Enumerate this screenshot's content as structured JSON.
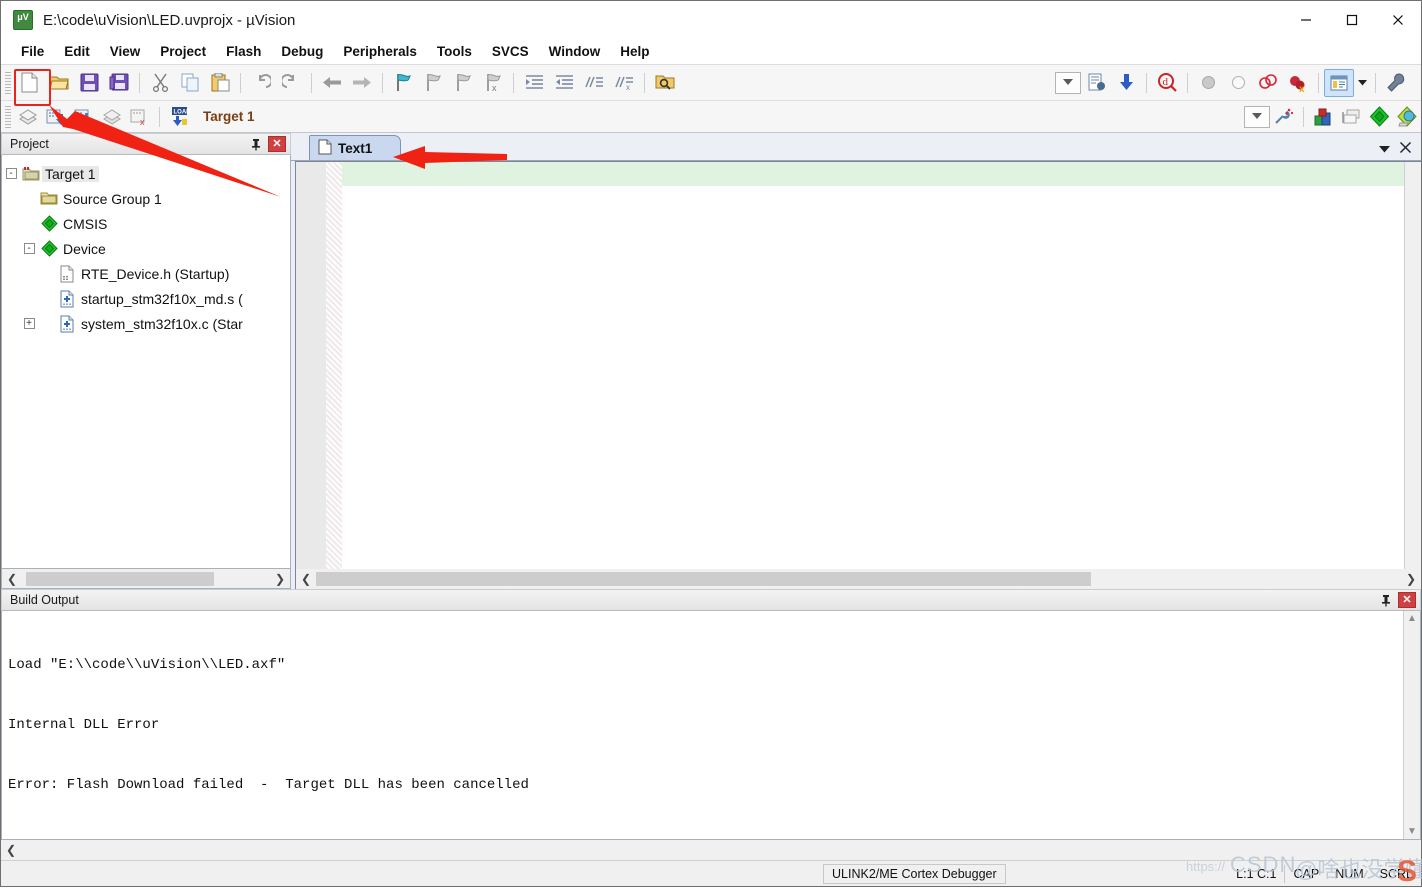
{
  "window": {
    "title": "E:\\code\\uVision\\LED.uvprojx - µVision",
    "app_icon": "uvision-logo-icon",
    "controls": {
      "minimize": "minimize-icon",
      "maximize": "maximize-icon",
      "close": "close-icon"
    }
  },
  "menubar": {
    "items": [
      "File",
      "Edit",
      "View",
      "Project",
      "Flash",
      "Debug",
      "Peripherals",
      "Tools",
      "SVCS",
      "Window",
      "Help"
    ]
  },
  "toolbar_main": {
    "buttons": [
      "new-file-icon",
      "open-file-icon",
      "save-icon",
      "save-all-icon",
      "cut-icon",
      "copy-icon",
      "paste-icon",
      "undo-icon",
      "redo-icon",
      "navigate-back-icon",
      "navigate-forward-icon",
      "bookmark-toggle-icon",
      "bookmark-prev-icon",
      "bookmark-next-icon",
      "bookmark-clear-icon",
      "indent-icon",
      "outdent-icon",
      "comment-icon",
      "uncomment-icon",
      "find-in-files-icon"
    ],
    "right_buttons": [
      "combo-dropdown-icon",
      "configure-target-icon",
      "download-icon",
      "start-debug-icon",
      "breakpoint-icon",
      "breakpoint-disable-icon",
      "breakpoint-kill-all-icon",
      "breakpoint-remove-icon",
      "manage-windows-icon",
      "manage-windows-caret-icon",
      "configure-icon"
    ]
  },
  "toolbar_build": {
    "buttons": [
      "translate-icon",
      "build-icon",
      "rebuild-icon",
      "batch-build-icon",
      "stop-build-icon",
      "download-to-flash-icon"
    ],
    "target_selector": {
      "value": "Target 1",
      "dropdown_icon": "chevron-down-icon"
    },
    "right_buttons": [
      "target-options-icon",
      "manage-project-items-icon",
      "packs-icon",
      "pack-installer-icon"
    ]
  },
  "project_panel": {
    "title": "Project",
    "pin_icon": "pin-icon",
    "close_icon": "close-icon",
    "tree": [
      {
        "label": "Target 1",
        "icon": "target-icon",
        "indent": 0,
        "expander": "-",
        "selected": true
      },
      {
        "label": "Source Group 1",
        "icon": "folder-icon",
        "indent": 1,
        "expander": "",
        "selected": false
      },
      {
        "label": "CMSIS",
        "icon": "diamond-icon",
        "indent": 1,
        "expander": "",
        "selected": false
      },
      {
        "label": "Device",
        "icon": "diamond-icon",
        "indent": 1,
        "expander": "-",
        "selected": false
      },
      {
        "label": "RTE_Device.h (Startup)",
        "icon": "header-file-icon",
        "indent": 2,
        "expander": "",
        "selected": false
      },
      {
        "label": "startup_stm32f10x_md.s (",
        "icon": "source-file-icon",
        "indent": 2,
        "expander": "",
        "selected": false
      },
      {
        "label": "system_stm32f10x.c (Star",
        "icon": "source-file-icon",
        "indent": 2,
        "expander": "+",
        "selected": false
      }
    ],
    "hscroll": {
      "left_arrow": "scroll-left-icon",
      "right_arrow": "scroll-right-icon"
    }
  },
  "editor": {
    "tabs": [
      {
        "label": "Text1",
        "icon": "document-icon",
        "active": true
      }
    ],
    "caret_icon": "chevron-down-icon",
    "close_icon": "close-icon",
    "content_lines": [
      ""
    ],
    "hscroll": {
      "left_arrow": "scroll-left-icon",
      "right_arrow": "scroll-right-icon"
    }
  },
  "build_output": {
    "title": "Build Output",
    "pin_icon": "pin-icon",
    "close_icon": "close-icon",
    "lines": [
      "Load \"E:\\\\code\\\\uVision\\\\LED.axf\"",
      "Internal DLL Error",
      "Error: Flash Download failed  -  Target DLL has been cancelled"
    ],
    "hscroll": {
      "left_arrow": "scroll-left-icon"
    }
  },
  "statusbar": {
    "debugger": "ULINK2/ME Cortex Debugger",
    "cursor_position": "L:1 C:1",
    "indicators": [
      "CAP",
      "NUM",
      "SCRL"
    ]
  },
  "annotations": {
    "highlight_box": "new-file-button-highlight",
    "arrow_to_new_file": "red-arrow-pointing-to-new-file-button",
    "arrow_to_tab": "red-arrow-pointing-to-text1-tab"
  },
  "watermark": {
    "url": "https://",
    "brand": "CSDN",
    "user": "@啥也没学懂"
  },
  "colors": {
    "accent_red": "#e8241c",
    "tab_active": "#c9d8ef",
    "current_line": "#dff3e0",
    "target_label": "#7a3f12"
  }
}
